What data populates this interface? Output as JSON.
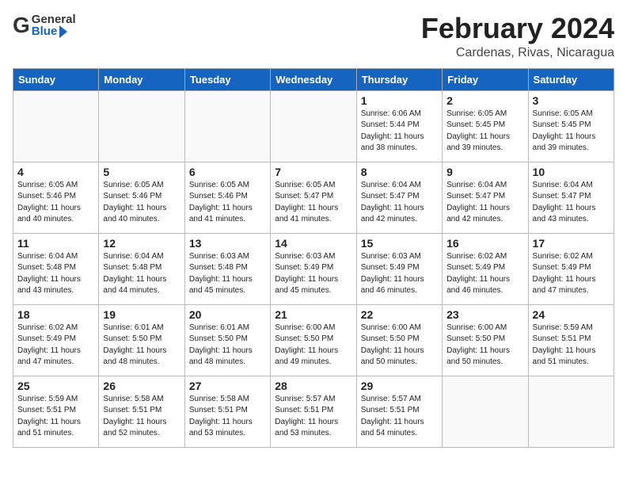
{
  "header": {
    "logo_general": "General",
    "logo_blue": "Blue",
    "month_title": "February 2024",
    "location": "Cardenas, Rivas, Nicaragua"
  },
  "calendar": {
    "days_of_week": [
      "Sunday",
      "Monday",
      "Tuesday",
      "Wednesday",
      "Thursday",
      "Friday",
      "Saturday"
    ],
    "weeks": [
      [
        {
          "day": "",
          "info": ""
        },
        {
          "day": "",
          "info": ""
        },
        {
          "day": "",
          "info": ""
        },
        {
          "day": "",
          "info": ""
        },
        {
          "day": "1",
          "info": "Sunrise: 6:06 AM\nSunset: 5:44 PM\nDaylight: 11 hours\nand 38 minutes."
        },
        {
          "day": "2",
          "info": "Sunrise: 6:05 AM\nSunset: 5:45 PM\nDaylight: 11 hours\nand 39 minutes."
        },
        {
          "day": "3",
          "info": "Sunrise: 6:05 AM\nSunset: 5:45 PM\nDaylight: 11 hours\nand 39 minutes."
        }
      ],
      [
        {
          "day": "4",
          "info": "Sunrise: 6:05 AM\nSunset: 5:46 PM\nDaylight: 11 hours\nand 40 minutes."
        },
        {
          "day": "5",
          "info": "Sunrise: 6:05 AM\nSunset: 5:46 PM\nDaylight: 11 hours\nand 40 minutes."
        },
        {
          "day": "6",
          "info": "Sunrise: 6:05 AM\nSunset: 5:46 PM\nDaylight: 11 hours\nand 41 minutes."
        },
        {
          "day": "7",
          "info": "Sunrise: 6:05 AM\nSunset: 5:47 PM\nDaylight: 11 hours\nand 41 minutes."
        },
        {
          "day": "8",
          "info": "Sunrise: 6:04 AM\nSunset: 5:47 PM\nDaylight: 11 hours\nand 42 minutes."
        },
        {
          "day": "9",
          "info": "Sunrise: 6:04 AM\nSunset: 5:47 PM\nDaylight: 11 hours\nand 42 minutes."
        },
        {
          "day": "10",
          "info": "Sunrise: 6:04 AM\nSunset: 5:47 PM\nDaylight: 11 hours\nand 43 minutes."
        }
      ],
      [
        {
          "day": "11",
          "info": "Sunrise: 6:04 AM\nSunset: 5:48 PM\nDaylight: 11 hours\nand 43 minutes."
        },
        {
          "day": "12",
          "info": "Sunrise: 6:04 AM\nSunset: 5:48 PM\nDaylight: 11 hours\nand 44 minutes."
        },
        {
          "day": "13",
          "info": "Sunrise: 6:03 AM\nSunset: 5:48 PM\nDaylight: 11 hours\nand 45 minutes."
        },
        {
          "day": "14",
          "info": "Sunrise: 6:03 AM\nSunset: 5:49 PM\nDaylight: 11 hours\nand 45 minutes."
        },
        {
          "day": "15",
          "info": "Sunrise: 6:03 AM\nSunset: 5:49 PM\nDaylight: 11 hours\nand 46 minutes."
        },
        {
          "day": "16",
          "info": "Sunrise: 6:02 AM\nSunset: 5:49 PM\nDaylight: 11 hours\nand 46 minutes."
        },
        {
          "day": "17",
          "info": "Sunrise: 6:02 AM\nSunset: 5:49 PM\nDaylight: 11 hours\nand 47 minutes."
        }
      ],
      [
        {
          "day": "18",
          "info": "Sunrise: 6:02 AM\nSunset: 5:49 PM\nDaylight: 11 hours\nand 47 minutes."
        },
        {
          "day": "19",
          "info": "Sunrise: 6:01 AM\nSunset: 5:50 PM\nDaylight: 11 hours\nand 48 minutes."
        },
        {
          "day": "20",
          "info": "Sunrise: 6:01 AM\nSunset: 5:50 PM\nDaylight: 11 hours\nand 48 minutes."
        },
        {
          "day": "21",
          "info": "Sunrise: 6:00 AM\nSunset: 5:50 PM\nDaylight: 11 hours\nand 49 minutes."
        },
        {
          "day": "22",
          "info": "Sunrise: 6:00 AM\nSunset: 5:50 PM\nDaylight: 11 hours\nand 50 minutes."
        },
        {
          "day": "23",
          "info": "Sunrise: 6:00 AM\nSunset: 5:50 PM\nDaylight: 11 hours\nand 50 minutes."
        },
        {
          "day": "24",
          "info": "Sunrise: 5:59 AM\nSunset: 5:51 PM\nDaylight: 11 hours\nand 51 minutes."
        }
      ],
      [
        {
          "day": "25",
          "info": "Sunrise: 5:59 AM\nSunset: 5:51 PM\nDaylight: 11 hours\nand 51 minutes."
        },
        {
          "day": "26",
          "info": "Sunrise: 5:58 AM\nSunset: 5:51 PM\nDaylight: 11 hours\nand 52 minutes."
        },
        {
          "day": "27",
          "info": "Sunrise: 5:58 AM\nSunset: 5:51 PM\nDaylight: 11 hours\nand 53 minutes."
        },
        {
          "day": "28",
          "info": "Sunrise: 5:57 AM\nSunset: 5:51 PM\nDaylight: 11 hours\nand 53 minutes."
        },
        {
          "day": "29",
          "info": "Sunrise: 5:57 AM\nSunset: 5:51 PM\nDaylight: 11 hours\nand 54 minutes."
        },
        {
          "day": "",
          "info": ""
        },
        {
          "day": "",
          "info": ""
        }
      ]
    ]
  }
}
